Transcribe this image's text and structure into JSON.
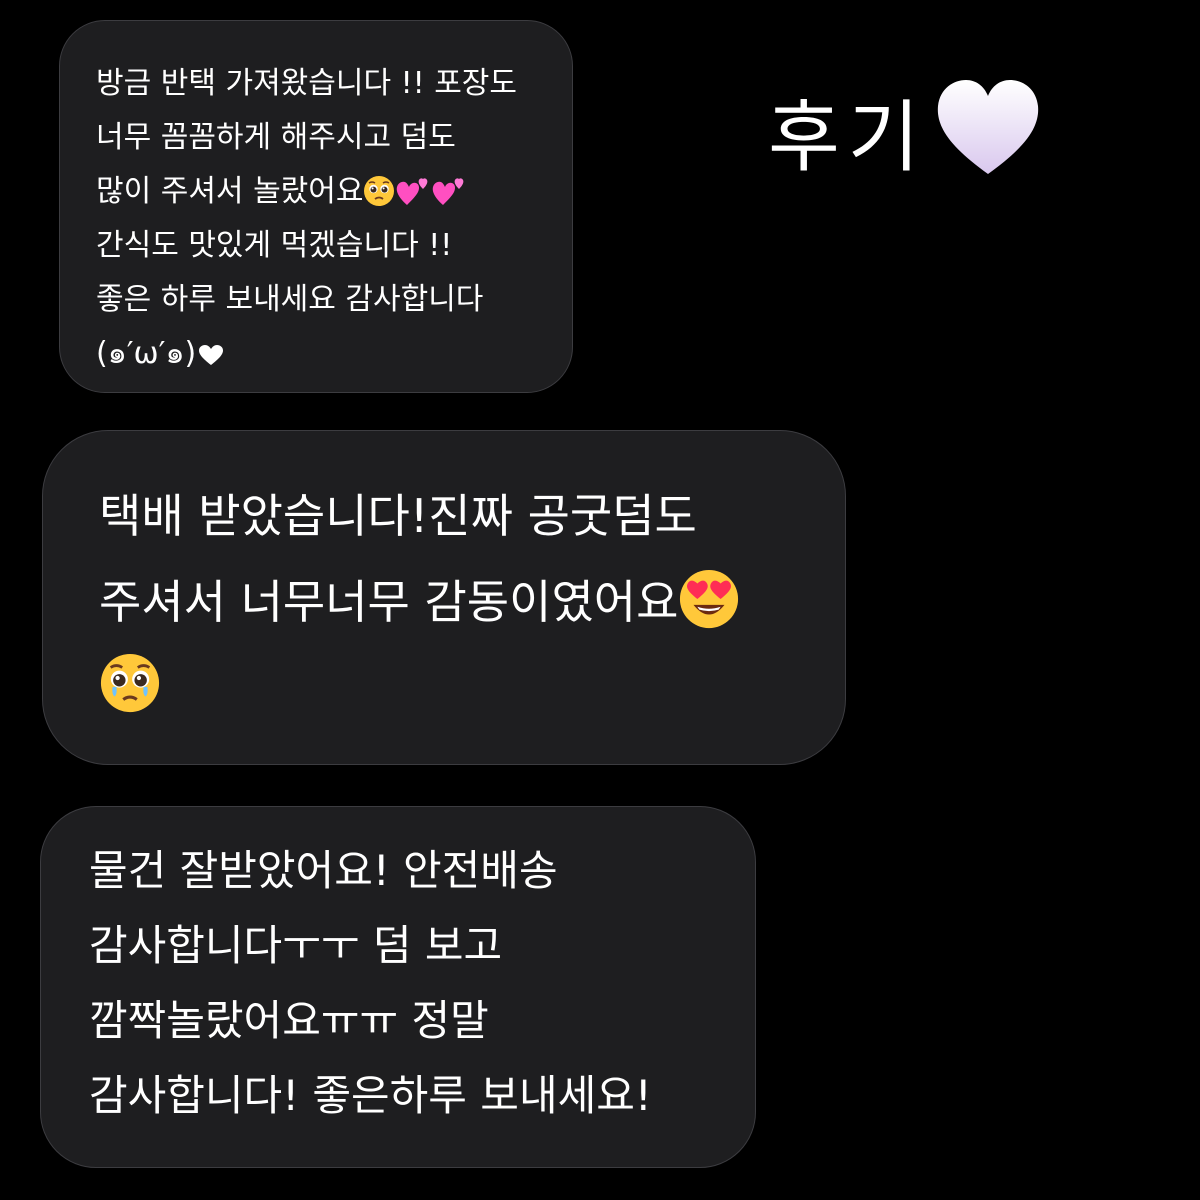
{
  "title": {
    "text": "후기",
    "heart_icon": "white-heart-icon"
  },
  "messages": [
    {
      "lines": [
        "방금 반택 가져왔습니다 !! 포장도",
        "너무 꼼꼼하게 해주시고 덤도",
        "많이 주셔서 놀랐어요",
        "간식도 맛있게 먹겠습니다 !!",
        "좋은 하루 보내세요 감사합니다",
        "(๑′ω′๑)"
      ],
      "line3_emojis": [
        "pleading-face-icon",
        "two-hearts-icon",
        "two-hearts-icon"
      ],
      "line6_emoji": "white-heart-icon"
    },
    {
      "lines": [
        "택배 받았습니다!진짜 공굿덤도",
        "주셔서 너무너무 감동이였어요"
      ],
      "line2_emoji": "heart-eyes-icon",
      "line3_emoji": "pleading-face-icon"
    },
    {
      "lines": [
        "물건 잘받았어요! 안전배송",
        "감사합니다ㅜㅜ 덤 보고",
        "깜짝놀랐어요ㅠㅠ 정말",
        "감사합니다! 좋은하루 보내세요!"
      ]
    }
  ],
  "colors": {
    "background": "#000000",
    "bubble": "#1e1e20",
    "bubble_border": "#3c3c40",
    "text": "#ffffff",
    "emoji_face": "#ffc83a",
    "pink_heart": "#ff4fc1"
  }
}
